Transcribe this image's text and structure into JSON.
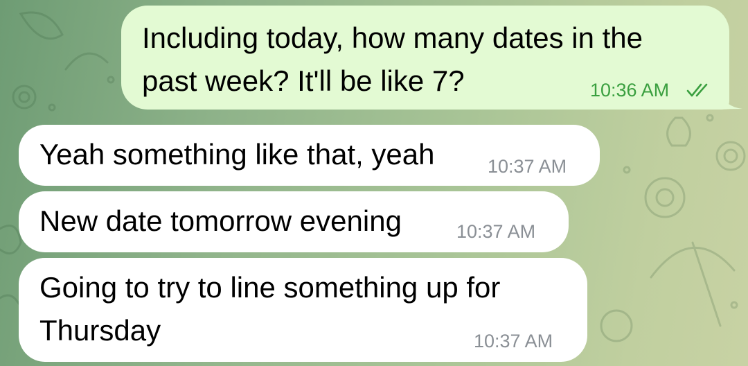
{
  "chat": {
    "messages": [
      {
        "direction": "outgoing",
        "text": "Including today, how many dates in the\npast week?  It'll be like 7?",
        "time": "10:36 AM",
        "status": "read",
        "status_icon": "double-check-icon"
      },
      {
        "direction": "incoming",
        "text": "Yeah something like that, yeah",
        "time": "10:37 AM"
      },
      {
        "direction": "incoming",
        "text": "New date tomorrow evening",
        "time": "10:37 AM"
      },
      {
        "direction": "incoming",
        "text": "Going to try to line something up for\nThursday",
        "time": "10:37 AM"
      }
    ]
  },
  "colors": {
    "outgoing_bubble": "#e3fad3",
    "incoming_bubble": "#ffffff",
    "outgoing_meta": "#3a9f3f",
    "incoming_meta": "#8a8f95"
  }
}
